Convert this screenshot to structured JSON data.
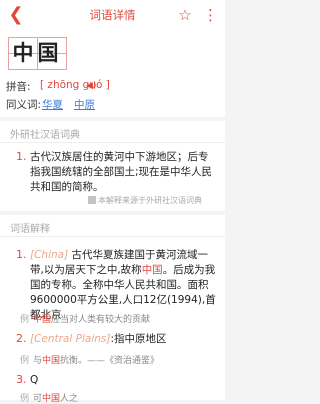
{
  "header": {
    "back_glyph": "❮",
    "title": "词语详情",
    "star_glyph": "☆",
    "more_glyph": "⋮"
  },
  "word": {
    "text": "中国",
    "pinyin_label": "拼音:",
    "pinyin": "[ zhōng guó ]",
    "sound_glyph": "◀)",
    "synonym_label": "同义词:",
    "synonyms": [
      "华夏",
      "中原"
    ]
  },
  "section1": {
    "title": "外研社汉语词典",
    "definitions": [
      {
        "num": "1.",
        "text": "古代汉族居住的黄河中下游地区；后专指我国统辖的全部国土;现在是中华人民共和国的简称。"
      }
    ],
    "source": "本解释来源于外研社汉语词典"
  },
  "section2": {
    "title": "词语解释",
    "definitions": [
      {
        "num": "1.",
        "tag": "[China]",
        "text_a": " 古代华夏族建国于黄河流域一带,以为居天下之中,故称",
        "hl": "中国",
        "text_b": "。后成为我国的专称。全称中华人民共和国。面积9600000平方公里,人口12亿(1994),首都北京",
        "example_label": "例",
        "example_hl": "中国",
        "example_rest": "应当对人类有较大的贡献"
      },
      {
        "num": "2.",
        "tag": "[Central Plains]",
        "text": ":指中原地区",
        "example_label": "例",
        "example_pre": "与",
        "example_hl": "中国",
        "example_rest": "抗衡。——《资治通鉴》"
      },
      {
        "num": "3.",
        "text": "Q",
        "example_label": "例",
        "example_pre": "可",
        "example_hl": "中国",
        "example_rest": "人之"
      }
    ]
  },
  "colors": {
    "accent": "#e0473a",
    "link": "#3c7ad9",
    "muted": "#aaaaaa"
  }
}
